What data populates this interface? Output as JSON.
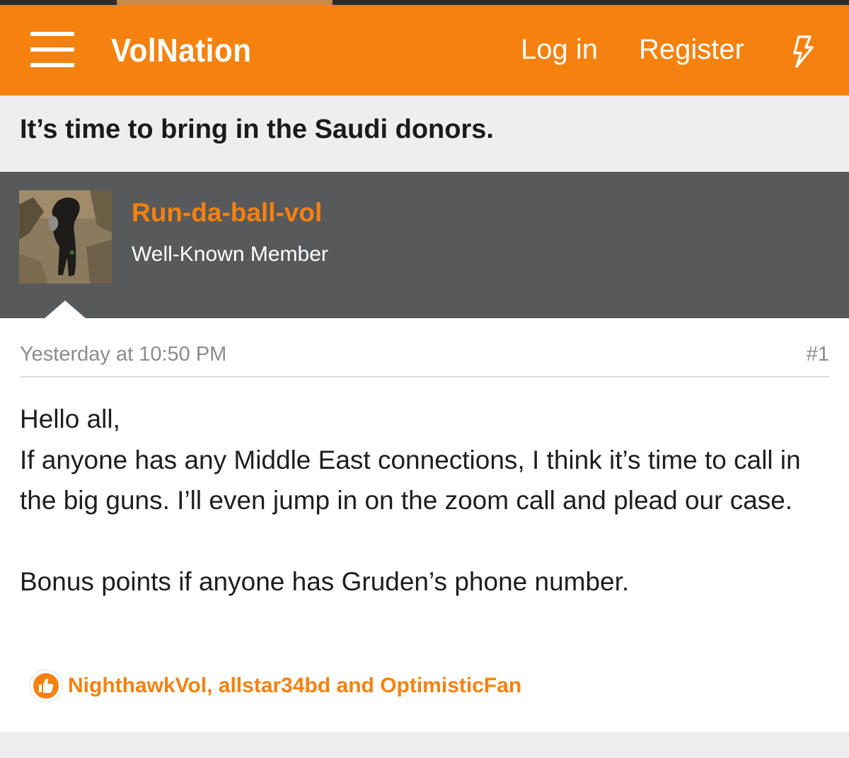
{
  "header": {
    "logo_text": "VolNation",
    "menu_icon": "hamburger-menu-icon",
    "login_label": "Log in",
    "register_label": "Register",
    "whats_new_icon": "lightning-bolt-icon",
    "brand_color": "#f5810f"
  },
  "thread": {
    "title": "It’s time to bring in the Saudi donors."
  },
  "post": {
    "author": {
      "name": "Run-da-ball-vol",
      "title": "Well-Known Member",
      "avatar": "avatar-photo-dog"
    },
    "timestamp": "Yesterday at 10:50 PM",
    "number": "#1",
    "body": [
      "Hello all,",
      "If anyone has any Middle East connections, I think it’s time to call in the big guns. I’ll even jump in on the zoom call and plead our case.",
      "Bonus points if anyone has Gruden’s phone number."
    ],
    "reactions": {
      "icon": "like-thumbs-up-icon",
      "users_text": "NighthawkVol, allstar34bd and OptimisticFan"
    }
  },
  "colors": {
    "user_band": "#58595b",
    "page_background": "#eeeeee"
  }
}
